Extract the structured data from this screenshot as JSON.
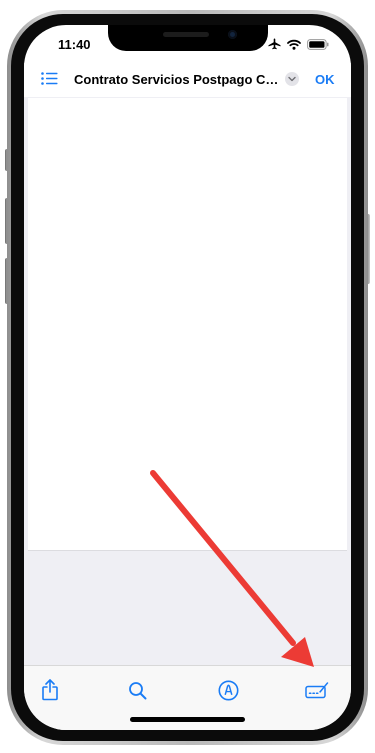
{
  "status_bar": {
    "time": "11:40",
    "icons": [
      "airplane-mode-icon",
      "wifi-icon",
      "battery-icon"
    ]
  },
  "nav": {
    "list_icon": "list-icon",
    "title": "Contrato Servicios Postpago CA...",
    "chevron_icon": "chevron-down-icon",
    "done_label": "OK"
  },
  "toolbar": {
    "items": [
      "share-icon",
      "search-icon",
      "markup-icon",
      "signature-icon"
    ]
  },
  "annotation": {
    "type": "arrow",
    "color": "#ec3b35",
    "points_to": "signature-icon"
  },
  "colors": {
    "accent": "#1a7cf5",
    "page_background": "#efeff4"
  }
}
